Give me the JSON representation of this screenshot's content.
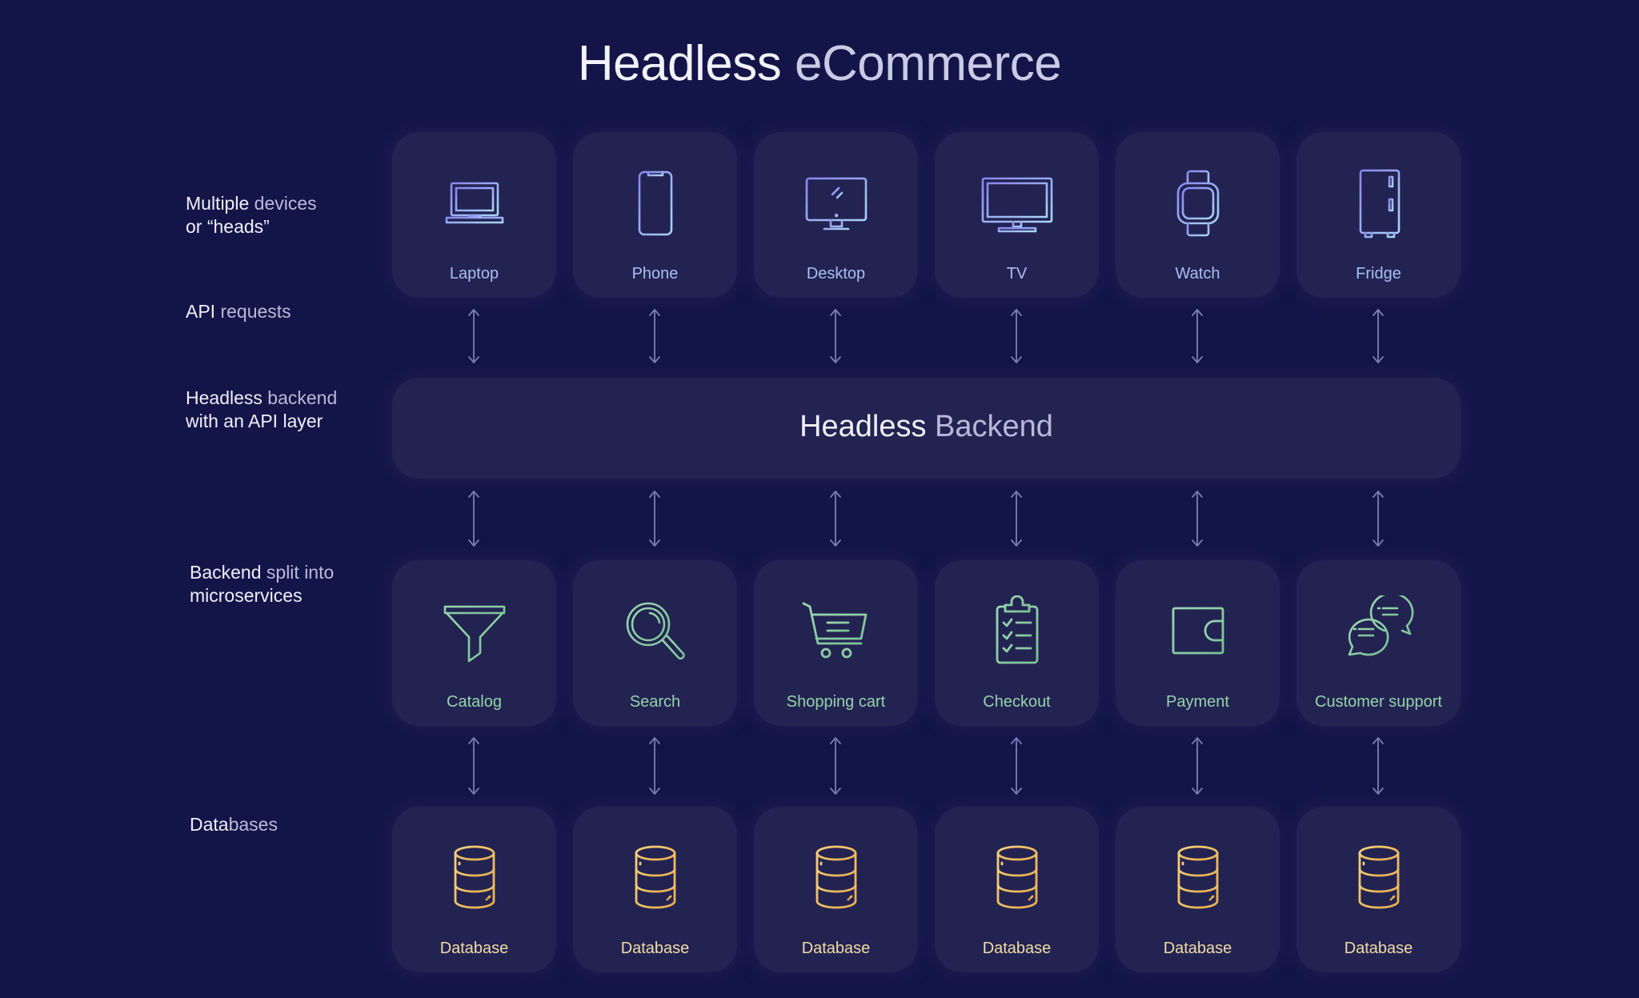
{
  "title": {
    "part1": "Headless",
    "part2": "eCommerce"
  },
  "row_labels": {
    "devices": {
      "strong": "Multiple",
      "dim": "devices",
      "line2": "or “heads”"
    },
    "api": {
      "strong": "API",
      "dim": "requests"
    },
    "backend": {
      "strong": "Headless",
      "dim": "backend",
      "line2": "with an API layer"
    },
    "microservices": {
      "strong": "Backend",
      "dim": "split into",
      "line2": "microservices"
    },
    "databases": {
      "strong": "Data",
      "dim": "bases"
    }
  },
  "devices": [
    {
      "label": "Laptop",
      "icon": "laptop-icon"
    },
    {
      "label": "Phone",
      "icon": "phone-icon"
    },
    {
      "label": "Desktop",
      "icon": "desktop-icon"
    },
    {
      "label": "TV",
      "icon": "tv-icon"
    },
    {
      "label": "Watch",
      "icon": "watch-icon"
    },
    {
      "label": "Fridge",
      "icon": "fridge-icon"
    }
  ],
  "backend": {
    "part1": "Headless",
    "part2": "Backend"
  },
  "microservices": [
    {
      "label": "Catalog",
      "icon": "funnel-icon"
    },
    {
      "label": "Search",
      "icon": "magnifier-icon"
    },
    {
      "label": "Shopping cart",
      "icon": "cart-icon"
    },
    {
      "label": "Checkout",
      "icon": "clipboard-checklist-icon"
    },
    {
      "label": "Payment",
      "icon": "wallet-icon"
    },
    {
      "label": "Customer support",
      "icon": "chat-bubbles-icon"
    }
  ],
  "databases": [
    {
      "label": "Database",
      "icon": "database-icon"
    },
    {
      "label": "Database",
      "icon": "database-icon"
    },
    {
      "label": "Database",
      "icon": "database-icon"
    },
    {
      "label": "Database",
      "icon": "database-icon"
    },
    {
      "label": "Database",
      "icon": "database-icon"
    },
    {
      "label": "Database",
      "icon": "database-icon"
    }
  ],
  "colors": {
    "background": "#131447",
    "card": "#232352",
    "device_icon": "#8fb6f0",
    "device_icon_alt": "#8a7ef0",
    "service_icon": "#8fd4a4",
    "database_icon": "#f2c266",
    "arrow": "#7b7fb8"
  }
}
